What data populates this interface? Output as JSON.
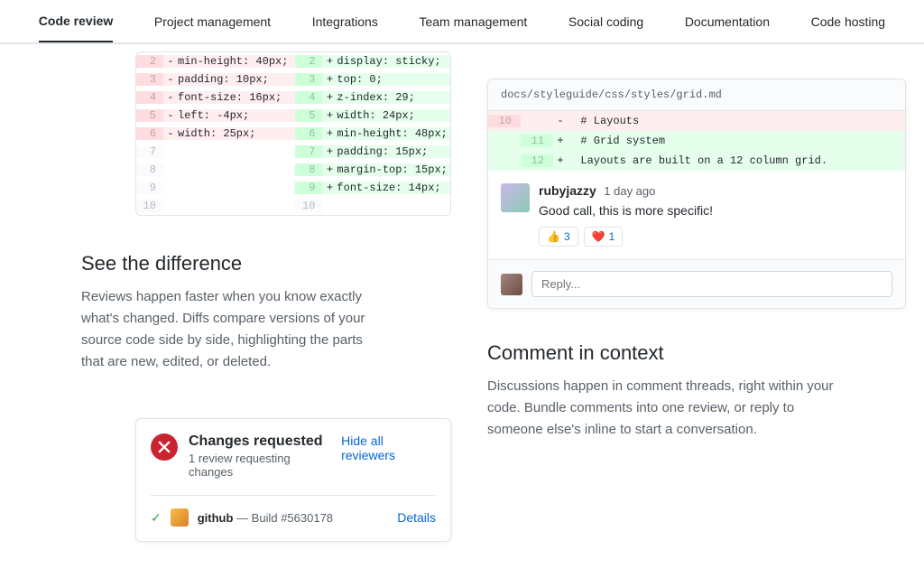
{
  "nav": [
    {
      "label": "Code review",
      "active": true
    },
    {
      "label": "Project management",
      "active": false
    },
    {
      "label": "Integrations",
      "active": false
    },
    {
      "label": "Team management",
      "active": false
    },
    {
      "label": "Social coding",
      "active": false
    },
    {
      "label": "Documentation",
      "active": false
    },
    {
      "label": "Code hosting",
      "active": false
    }
  ],
  "diff_left": [
    {
      "n": "2",
      "t": "del",
      "m": "-",
      "c": "min-height: 40px;"
    },
    {
      "n": "3",
      "t": "del",
      "m": "-",
      "c": "padding: 10px;"
    },
    {
      "n": "4",
      "t": "del",
      "m": "-",
      "c": "font-size: 16px;"
    },
    {
      "n": "5",
      "t": "del",
      "m": "-",
      "c": "left: -4px;"
    },
    {
      "n": "6",
      "t": "del",
      "m": "-",
      "c": "width: 25px;"
    },
    {
      "n": "7",
      "t": "ctx",
      "m": "",
      "c": ""
    },
    {
      "n": "8",
      "t": "ctx",
      "m": "",
      "c": ""
    },
    {
      "n": "9",
      "t": "ctx",
      "m": "",
      "c": ""
    },
    {
      "n": "10",
      "t": "ctx",
      "m": "",
      "c": ""
    }
  ],
  "diff_right": [
    {
      "n": "2",
      "t": "add",
      "m": "+",
      "c": "display: sticky;"
    },
    {
      "n": "3",
      "t": "add",
      "m": "+",
      "c": "top: 0;"
    },
    {
      "n": "4",
      "t": "add",
      "m": "+",
      "c": "z-index: 29;"
    },
    {
      "n": "5",
      "t": "add",
      "m": "+",
      "c": "width: 24px;"
    },
    {
      "n": "6",
      "t": "add",
      "m": "+",
      "c": "min-height: 48px;"
    },
    {
      "n": "7",
      "t": "add",
      "m": "+",
      "c": "padding: 15px;"
    },
    {
      "n": "8",
      "t": "add",
      "m": "+",
      "c": "margin-top: 15px;"
    },
    {
      "n": "9",
      "t": "add",
      "m": "+",
      "c": "font-size: 14px;"
    },
    {
      "n": "10",
      "t": "ctx",
      "m": "",
      "c": ""
    }
  ],
  "section1": {
    "title": "See the difference",
    "body": "Reviews happen faster when you know exactly what's changed. Diffs compare versions of your source code side by side, highlighting the parts that are new, edited, or deleted."
  },
  "merge": {
    "title": "Changes requested",
    "sub": "1 review requesting changes",
    "link": "Hide all reviewers",
    "build_bot": "github",
    "build_text": " — Build #5630178",
    "details": "Details"
  },
  "comment_file": "docs/styleguide/css/styles/grid.md",
  "inline_diff": [
    {
      "n1": "10",
      "n2": "",
      "t": "idel",
      "m": "-",
      "c": "# Layouts"
    },
    {
      "n1": "",
      "n2": "11",
      "t": "iadd",
      "m": "+",
      "c": "# Grid system"
    },
    {
      "n1": "",
      "n2": "12",
      "t": "iadd",
      "m": "+",
      "c": "Layouts are built on a 12 column grid."
    }
  ],
  "comment": {
    "author": "rubyjazzy",
    "time": "1 day ago",
    "body": "Good call, this is more specific!",
    "react1_emoji": "👍",
    "react1_count": "3",
    "react2_emoji": "❤️",
    "react2_count": "1",
    "reply_placeholder": "Reply..."
  },
  "section2": {
    "title": "Comment in context",
    "body": "Discussions happen in comment threads, right within your code. Bundle comments into one review, or reply to someone else's inline to start a conversation."
  }
}
